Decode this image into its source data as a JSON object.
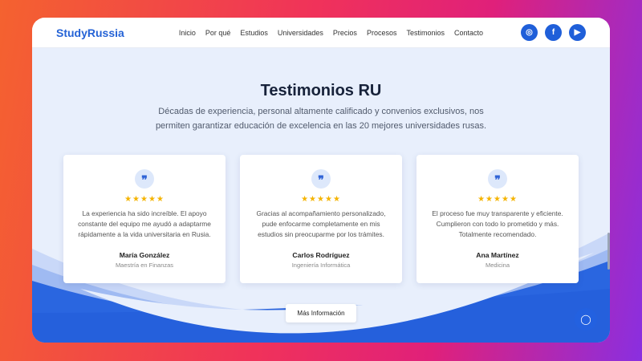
{
  "header": {
    "logo": "StudyRussia",
    "nav": [
      "Inicio",
      "Por qué",
      "Estudios",
      "Universidades",
      "Precios",
      "Procesos",
      "Testimonios",
      "Contacto"
    ],
    "social": [
      "instagram-icon",
      "facebook-icon",
      "youtube-icon"
    ]
  },
  "section": {
    "title": "Testimonios RU",
    "subtitle": "Décadas de experiencia, personal altamente calificado y convenios exclusivos, nos permiten garantizar educación de excelencia en las 20 mejores universidades rusas."
  },
  "testimonials": [
    {
      "rating": 5,
      "stars": "★★★★★",
      "text": "La experiencia ha sido increíble. El apoyo constante del equipo me ayudó a adaptarme rápidamente a la vida universitaria en Rusia.",
      "name": "María González",
      "role": "Maestría en Finanzas"
    },
    {
      "rating": 5,
      "stars": "★★★★★",
      "text": "Gracias al acompañamiento personalizado, pude enfocarme completamente en mis estudios sin preocuparme por los trámites.",
      "name": "Carlos Rodríguez",
      "role": "Ingeniería Informática"
    },
    {
      "rating": 5,
      "stars": "★★★★★",
      "text": "El proceso fue muy transparente y eficiente. Cumplieron con todo lo prometido y más. Totalmente recomendado.",
      "name": "Ana Martínez",
      "role": "Medicina"
    }
  ],
  "more_button": "Más Información",
  "colors": {
    "accent": "#2563d6"
  }
}
